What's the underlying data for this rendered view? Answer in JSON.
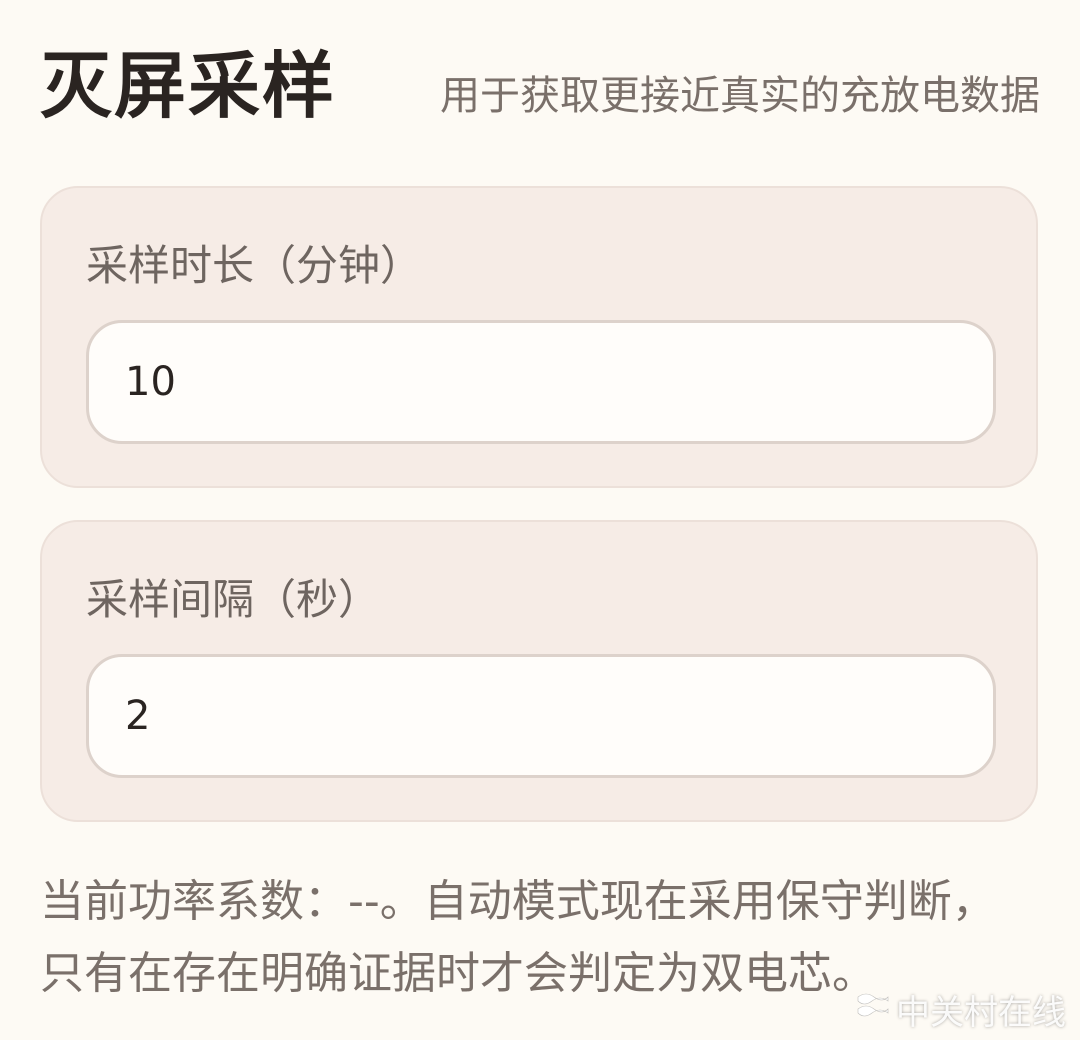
{
  "header": {
    "title": "灭屏采样",
    "subtitle": "用于获取更接近真实的充放电数据"
  },
  "duration": {
    "label": "采样时长（分钟）",
    "value": "10"
  },
  "interval": {
    "label": "采样间隔（秒）",
    "value": "2"
  },
  "footnote": "当前功率系数：--。自动模式现在采用保守判断，只有在存在明确证据时才会判定为双电芯。",
  "watermark": {
    "text": "中关村在线",
    "icon": "zol-logo-icon"
  }
}
